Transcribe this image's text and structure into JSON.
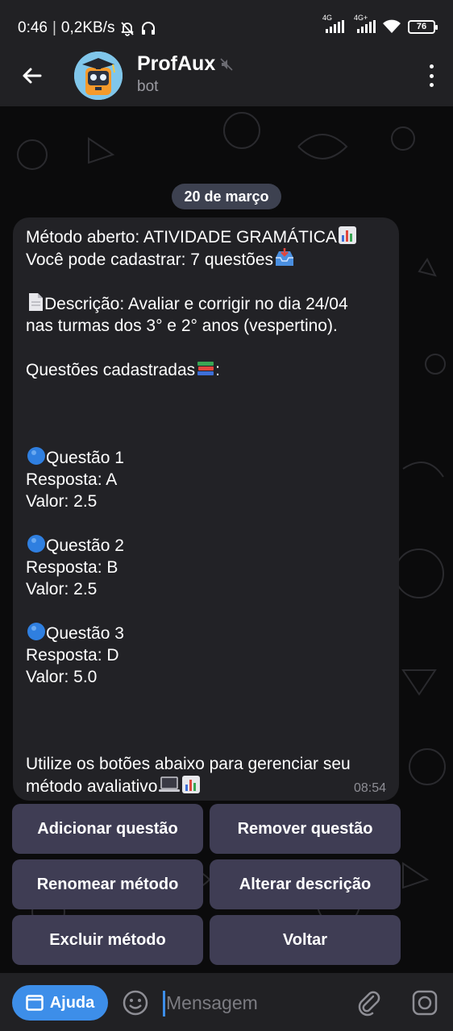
{
  "status_bar": {
    "time": "0:46",
    "separator": "|",
    "speed": "0,2KB/s",
    "signal1_label": "4G",
    "signal2_label": "4G+",
    "battery": "76"
  },
  "header": {
    "title": "ProfAux",
    "subtitle": "bot"
  },
  "chat": {
    "date": "20 de março",
    "message": {
      "line1": "Método aberto: ATIVIDADE GRAMÁTICA",
      "line2": "Você pode cadastrar: 7 questões",
      "description_line1": "Descrição: Avaliar e corrigir no dia 24/04",
      "description_line2": "nas turmas dos 3° e 2° anos (vespertino).",
      "questions_heading": "Questões cadastradas",
      "questions": [
        {
          "title": "Questão 1",
          "answer": "Resposta: A",
          "value": "Valor: 2.5"
        },
        {
          "title": "Questão 2",
          "answer": "Resposta: B",
          "value": "Valor: 2.5"
        },
        {
          "title": "Questão 3",
          "answer": "Resposta: D",
          "value": "Valor: 5.0"
        }
      ],
      "footer_line1": "Utilize os botões abaixo para gerenciar seu",
      "footer_line2": "método avaliativo",
      "time": "08:54"
    }
  },
  "keyboard": {
    "add": "Adicionar questão",
    "remove": "Remover questão",
    "rename": "Renomear método",
    "edit_description": "Alterar descrição",
    "delete": "Excluir método",
    "back": "Voltar"
  },
  "input_bar": {
    "help_label": "Ajuda",
    "placeholder": "Mensagem"
  },
  "colors": {
    "accent": "#3d8ee9",
    "bubble": "#222226",
    "button": "#3f3d54",
    "date_pill": "#3d4150"
  }
}
